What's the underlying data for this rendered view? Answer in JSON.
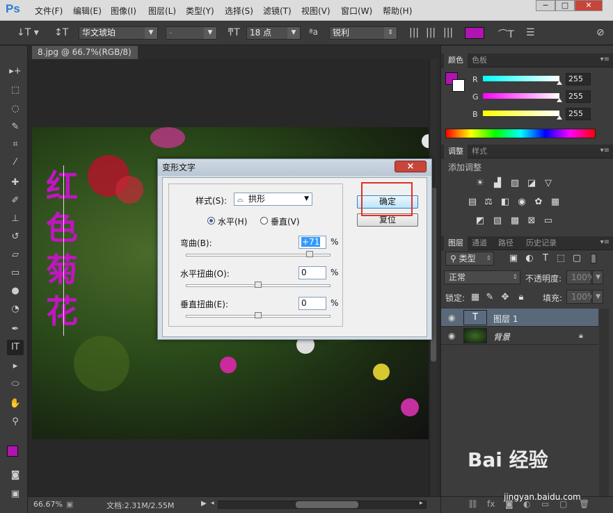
{
  "app": {
    "logo": "Ps"
  },
  "menu": [
    "文件(F)",
    "编辑(E)",
    "图像(I)",
    "图层(L)",
    "类型(Y)",
    "选择(S)",
    "滤镜(T)",
    "视图(V)",
    "窗口(W)",
    "帮助(H)"
  ],
  "window_controls": {
    "min": "−",
    "max": "□",
    "close": "✕"
  },
  "options_bar": {
    "font_family": "华文琥珀",
    "font_style": "-",
    "font_size": "18 点",
    "aa_label": "ªa",
    "anti_alias": "锐利",
    "text_color": "#b014b0"
  },
  "document": {
    "tab_title": "8.jpg @ 66.7%(RGB/8)",
    "tab_close": "×",
    "vertical_text": "红色菊花"
  },
  "status": {
    "zoom": "66.67%",
    "doc_info": "文档:2.31M/2.55M"
  },
  "colors": {
    "foreground": "#b014b0",
    "background": "#ffffff"
  },
  "color_panel": {
    "tabs": [
      "颜色",
      "色板"
    ],
    "channels": [
      {
        "label": "R",
        "value": "255"
      },
      {
        "label": "G",
        "value": "255"
      },
      {
        "label": "B",
        "value": "255"
      }
    ]
  },
  "adjustments_panel": {
    "tabs": [
      "调整",
      "样式"
    ],
    "title": "添加调整"
  },
  "layers_panel": {
    "tabs": [
      "图层",
      "通道",
      "路径",
      "历史记录"
    ],
    "filter": "类型",
    "blend_mode": "正常",
    "opacity_label": "不透明度:",
    "opacity_value": "100%",
    "lock_label": "锁定:",
    "fill_label": "填充:",
    "fill_value": "100%",
    "layers": [
      {
        "name": "图层 1",
        "thumb": "T"
      },
      {
        "name": "背景"
      }
    ]
  },
  "dialog": {
    "title": "变形文字",
    "close": "×",
    "style_label": "样式(S):",
    "style_value": "拱形",
    "horizontal_label": "水平(H)",
    "vertical_label": "垂直(V)",
    "bend_label": "弯曲(B):",
    "bend_value": "+71",
    "hdist_label": "水平扭曲(O):",
    "hdist_value": "0",
    "vdist_label": "垂直扭曲(E):",
    "vdist_value": "0",
    "percent": "%",
    "ok": "确定",
    "reset": "复位",
    "bend_level": 0.855,
    "hdist_level": 0.5,
    "vdist_level": 0.5
  },
  "watermark": {
    "brand": "Bai 经验",
    "url": "jingyan.baidu.com"
  }
}
